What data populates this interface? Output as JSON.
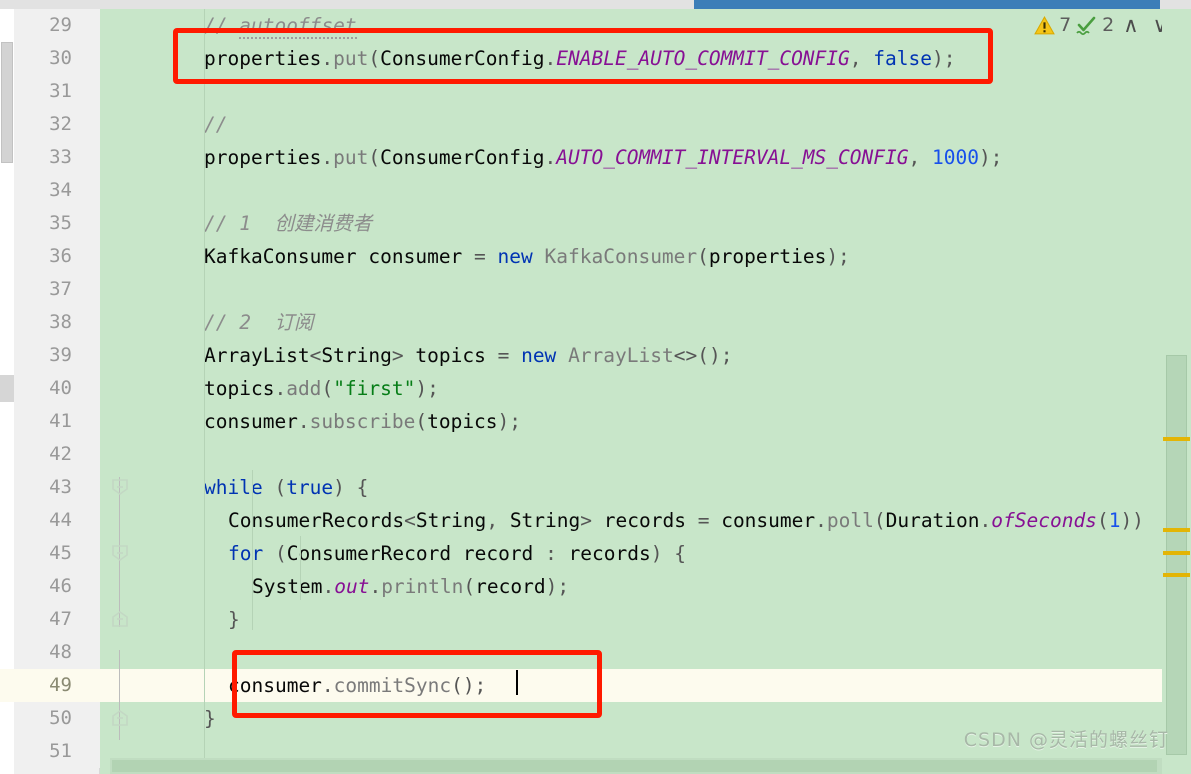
{
  "editor": {
    "language": "java",
    "background_color": "#c8e6c9",
    "current_line_color": "#fdfbee",
    "highlight_color": "#fae5bb",
    "annotation_box_color": "#ff1a00",
    "first_line": 29,
    "last_line": 51,
    "current_line": 49
  },
  "inspection_widget": {
    "warning_icon": "warning-triangle-icon",
    "warning_count": "7",
    "ok_icon": "green-check-squiggle-icon",
    "ok_count": "2",
    "prev_label": "∧",
    "next_label": "∨",
    "warning_color": "#f5c518",
    "ok_color": "#4caf50"
  },
  "lines": [
    {
      "num": "29",
      "indent": 2,
      "text": "// autooffset"
    },
    {
      "num": "30",
      "indent": 2,
      "text": "properties.put(ConsumerConfig.ENABLE_AUTO_COMMIT_CONFIG, false);"
    },
    {
      "num": "31",
      "indent": 0,
      "text": ""
    },
    {
      "num": "32",
      "indent": 2,
      "text": "//"
    },
    {
      "num": "33",
      "indent": 2,
      "text": "properties.put(ConsumerConfig.AUTO_COMMIT_INTERVAL_MS_CONFIG, 1000);"
    },
    {
      "num": "34",
      "indent": 0,
      "text": ""
    },
    {
      "num": "35",
      "indent": 2,
      "text": "// 1  创建消费者"
    },
    {
      "num": "36",
      "indent": 2,
      "text": "KafkaConsumer consumer = new KafkaConsumer(properties);"
    },
    {
      "num": "37",
      "indent": 0,
      "text": ""
    },
    {
      "num": "38",
      "indent": 2,
      "text": "// 2  订阅"
    },
    {
      "num": "39",
      "indent": 2,
      "text": "ArrayList<String> topics = new ArrayList<>();"
    },
    {
      "num": "40",
      "indent": 2,
      "text": "topics.add(\"first\");"
    },
    {
      "num": "41",
      "indent": 2,
      "text": "consumer.subscribe(topics);"
    },
    {
      "num": "42",
      "indent": 0,
      "text": ""
    },
    {
      "num": "43",
      "indent": 2,
      "text": "while (true) {"
    },
    {
      "num": "44",
      "indent": 3,
      "text": "ConsumerRecords<String, String> records = consumer.poll(Duration.ofSeconds(1))"
    },
    {
      "num": "45",
      "indent": 3,
      "text": "for (ConsumerRecord record : records) {"
    },
    {
      "num": "46",
      "indent": 4,
      "text": "System.out.println(record);"
    },
    {
      "num": "47",
      "indent": 3,
      "text": "}"
    },
    {
      "num": "48",
      "indent": 0,
      "text": ""
    },
    {
      "num": "49",
      "indent": 3,
      "text": "consumer.commitSync();"
    },
    {
      "num": "50",
      "indent": 2,
      "text": "}"
    },
    {
      "num": "51",
      "indent": 0,
      "text": ""
    }
  ],
  "fold_markers": [
    {
      "line": "43",
      "direction": "down"
    },
    {
      "line": "45",
      "direction": "down"
    },
    {
      "line": "47",
      "direction": "up"
    },
    {
      "line": "50",
      "direction": "up"
    }
  ],
  "annotations": [
    {
      "id": "box-1",
      "target_line": "30",
      "label": "disable-auto-commit-highlight"
    },
    {
      "id": "box-2",
      "target_line": "49",
      "label": "manual-commit-sync-highlight"
    }
  ],
  "watermark": {
    "text": "CSDN @灵活的螺丝钉"
  }
}
